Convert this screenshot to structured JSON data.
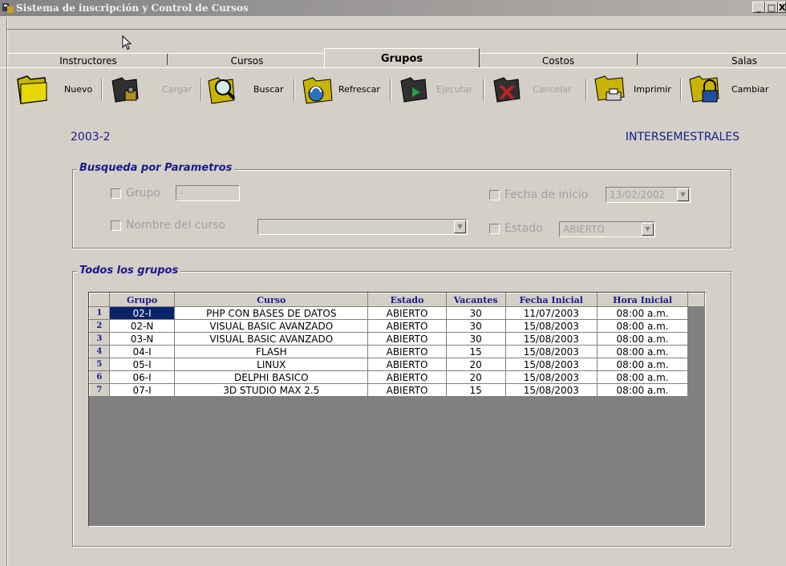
{
  "window": {
    "title": "Sistema de inscripción y Control de Cursos",
    "minimize": "_",
    "maximize": "□",
    "close": "X"
  },
  "tabs": [
    {
      "label": "Instructores"
    },
    {
      "label": "Cursos"
    },
    {
      "label": "Grupos"
    },
    {
      "label": "Costos"
    },
    {
      "label": "Salas"
    }
  ],
  "toolbar": {
    "nuevo": "Nuevo",
    "cargar": "Cargar",
    "buscar": "Buscar",
    "refrescar": "Refrescar",
    "ejecutar": "Ejecutar",
    "cancelar": "Cancelar",
    "imprimir": "Imprimir",
    "cambiar": "Cambiar"
  },
  "period": "2003-2",
  "session_type": "INTERSEMESTRALES",
  "search": {
    "legend": "Busqueda por Parametros",
    "grupo_label": "Grupo",
    "grupo_value": "-",
    "fecha_label": "Fecha de inicio",
    "fecha_value": "13/02/2002",
    "curso_label": "Nombre del curso",
    "curso_value": "",
    "estado_label": "Estado",
    "estado_value": "ABIERTO"
  },
  "groups": {
    "legend": "Todos los grupos",
    "columns": [
      "Grupo",
      "Curso",
      "Estado",
      "Vacantes",
      "Fecha Inicial",
      "Hora Inicial"
    ],
    "rows": [
      {
        "n": "1",
        "grupo": "02-I",
        "curso": "PHP CON BASES DE DATOS",
        "estado": "ABIERTO",
        "vacantes": "30",
        "fecha": "11/07/2003",
        "hora": "08:00 a.m."
      },
      {
        "n": "2",
        "grupo": "02-N",
        "curso": "VISUAL BASIC AVANZADO",
        "estado": "ABIERTO",
        "vacantes": "30",
        "fecha": "15/08/2003",
        "hora": "08:00 a.m."
      },
      {
        "n": "3",
        "grupo": "03-N",
        "curso": "VISUAL BASIC AVANZADO",
        "estado": "ABIERTO",
        "vacantes": "30",
        "fecha": "15/08/2003",
        "hora": "08:00 a.m."
      },
      {
        "n": "4",
        "grupo": "04-I",
        "curso": "FLASH",
        "estado": "ABIERTO",
        "vacantes": "15",
        "fecha": "15/08/2003",
        "hora": "08:00 a.m."
      },
      {
        "n": "5",
        "grupo": "05-I",
        "curso": "LINUX",
        "estado": "ABIERTO",
        "vacantes": "20",
        "fecha": "15/08/2003",
        "hora": "08:00 a.m."
      },
      {
        "n": "6",
        "grupo": "06-I",
        "curso": "DELPHI BASICO",
        "estado": "ABIERTO",
        "vacantes": "20",
        "fecha": "15/08/2003",
        "hora": "08:00 a.m."
      },
      {
        "n": "7",
        "grupo": "07-I",
        "curso": "3D STUDIO MAX 2.5",
        "estado": "ABIERTO",
        "vacantes": "15",
        "fecha": "15/08/2003",
        "hora": "08:00 a.m."
      }
    ]
  },
  "colors": {
    "accent": "#1a1a8c",
    "selection": "#0a246a",
    "face": "#d4d0c8"
  }
}
